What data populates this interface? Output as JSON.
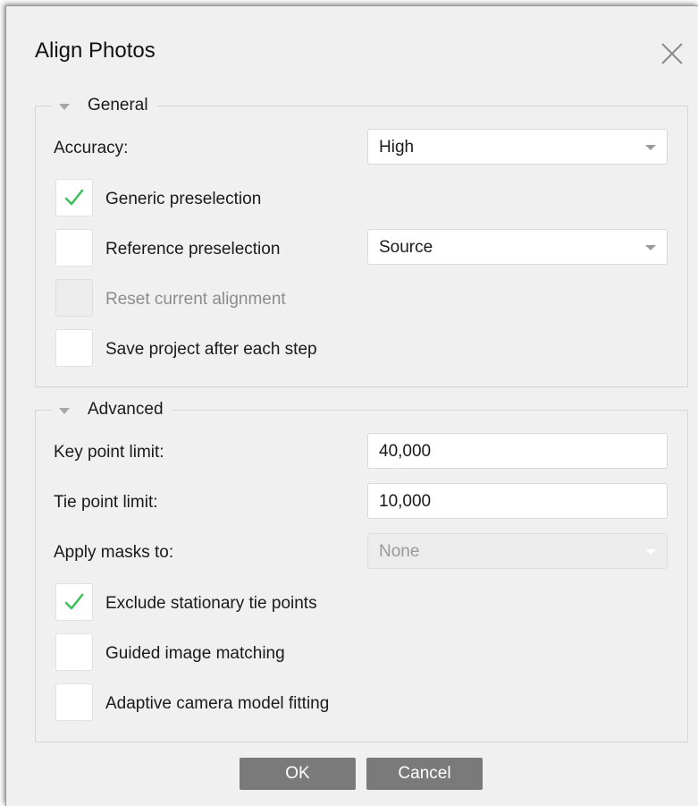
{
  "dialog": {
    "title": "Align Photos",
    "close_icon": "close-icon"
  },
  "general": {
    "legend": "General",
    "accuracy_label": "Accuracy:",
    "accuracy_value": "High",
    "generic_preselection": {
      "label": "Generic preselection",
      "checked": true
    },
    "reference_preselection": {
      "label": "Reference preselection",
      "checked": false,
      "value": "Source"
    },
    "reset_alignment": {
      "label": "Reset current alignment",
      "checked": false,
      "disabled": true
    },
    "save_project": {
      "label": "Save project after each step",
      "checked": false
    }
  },
  "advanced": {
    "legend": "Advanced",
    "key_point_label": "Key point limit:",
    "key_point_value": "40,000",
    "tie_point_label": "Tie point limit:",
    "tie_point_value": "10,000",
    "apply_masks_label": "Apply masks to:",
    "apply_masks_value": "None",
    "exclude_stationary": {
      "label": "Exclude stationary tie points",
      "checked": true
    },
    "guided_matching": {
      "label": "Guided image matching",
      "checked": false
    },
    "adaptive_fitting": {
      "label": "Adaptive camera model fitting",
      "checked": false
    }
  },
  "buttons": {
    "ok": "OK",
    "cancel": "Cancel"
  },
  "colors": {
    "check_green": "#3cc15a",
    "button_gray": "#7a7a7a",
    "dialog_bg": "#f0f0f0"
  }
}
